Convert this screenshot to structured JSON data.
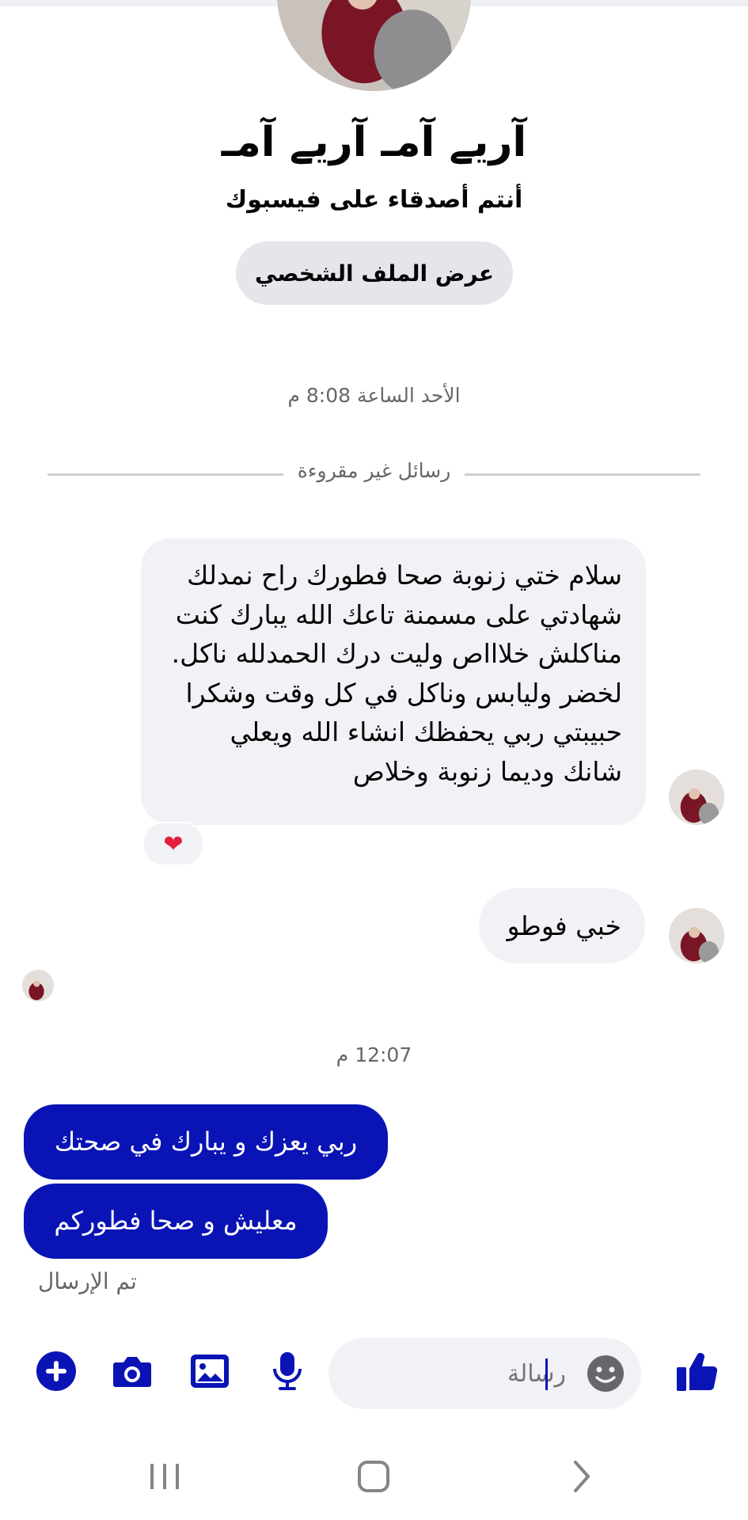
{
  "profile": {
    "name": "آريے آمـ آريے آمـ",
    "subtitle": "أنتم أصدقاء على فيسبوك",
    "view_profile_label": "عرض الملف الشخصي"
  },
  "conversation": {
    "timestamp_1": "الأحد الساعة 8:08 م",
    "unread_divider": "رسائل غير مقروءة",
    "incoming_1_lines": [
      "سلام ختي زنوبة صحا فطورك راح نمدلك",
      "شهادتي على مسمنة تاعك الله يبارك كنت",
      "مناكلش خلاااص وليت درك الحمدلله ناكل.",
      "لخضر وليابس وناكل في كل وقت وشكرا",
      "حبيبتي ربي يحفظك انشاء الله ويعلي",
      "شانك وديما زنوبة وخلاص"
    ],
    "reaction": "❤",
    "incoming_2": "خبي فوطو",
    "timestamp_2": "12:07 م",
    "outgoing_1": "ربي يعزك و يبارك في صحتك",
    "outgoing_2": "معليش و صحا فطوركم",
    "sent_status": "تم الإرسال"
  },
  "composer": {
    "placeholder": "رسالة",
    "icons": [
      "plus-icon",
      "camera-icon",
      "image-icon",
      "microphone-icon",
      "emoji-icon",
      "thumbs-up-icon"
    ]
  },
  "nav": {
    "icons": [
      "recents-icon",
      "home-icon",
      "back-icon"
    ]
  },
  "colors": {
    "accent": "#0a14b5",
    "bubble_incoming": "#f0f2f5",
    "secondary_text": "#65676b",
    "heart": "#e41e3f"
  }
}
